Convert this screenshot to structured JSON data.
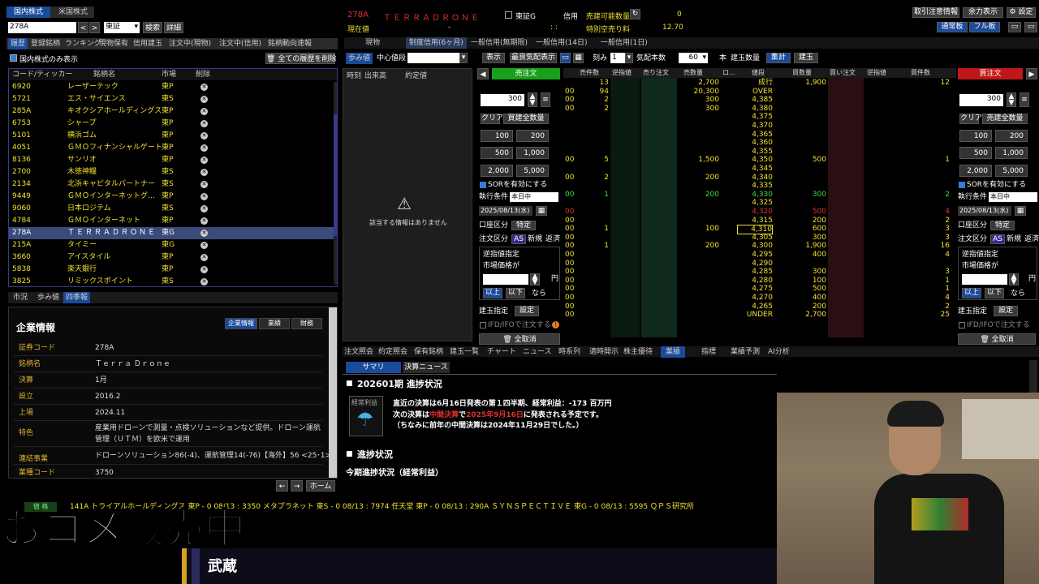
{
  "top_left": {
    "tab_jp": "国内株式",
    "tab_us": "米国株式",
    "code_input": "278A",
    "market": "東証",
    "search": "検索",
    "detail": "詳細"
  },
  "nav_tabs": [
    "履歴",
    "登録銘柄",
    "ランキング",
    "現物保有",
    "信用建玉",
    "注文中(現物)",
    "注文中(信用)",
    "銘柄動向速報"
  ],
  "domestic_only": "国内株式のみ表示",
  "clear_history": "全ての履歴を削除",
  "list_headers": {
    "code": "コード/ティッカー",
    "name": "銘柄名",
    "market": "市場",
    "del": "削除"
  },
  "stocks": [
    {
      "code": "6920",
      "name": "レーザーテック",
      "mkt": "東P"
    },
    {
      "code": "5721",
      "name": "エス・サイエンス",
      "mkt": "東S"
    },
    {
      "code": "285A",
      "name": "キオクシアホールディングス",
      "mkt": "東P"
    },
    {
      "code": "6753",
      "name": "シャープ",
      "mkt": "東P"
    },
    {
      "code": "5101",
      "name": "横浜ゴム",
      "mkt": "東P"
    },
    {
      "code": "4051",
      "name": "ＧＭＯフィナンシャルゲート",
      "mkt": "東P"
    },
    {
      "code": "8136",
      "name": "サンリオ",
      "mkt": "東P"
    },
    {
      "code": "2700",
      "name": "木徳神糧",
      "mkt": "東S"
    },
    {
      "code": "2134",
      "name": "北浜キャピタルパートナー",
      "mkt": "東S"
    },
    {
      "code": "9449",
      "name": "ＧＭＯインターネットグ…",
      "mkt": "東P"
    },
    {
      "code": "9060",
      "name": "日本ロジテム",
      "mkt": "東S"
    },
    {
      "code": "4784",
      "name": "ＧＭＯインターネット",
      "mkt": "東P"
    },
    {
      "code": "278A",
      "name": "ＴＥＲＲＡＤＲＯＮＥ",
      "mkt": "東G"
    },
    {
      "code": "215A",
      "name": "タイミー",
      "mkt": "東G"
    },
    {
      "code": "3660",
      "name": "アイスタイル",
      "mkt": "東P"
    },
    {
      "code": "5838",
      "name": "楽天銀行",
      "mkt": "東P"
    },
    {
      "code": "3825",
      "name": "リミックスポイント",
      "mkt": "東S"
    }
  ],
  "info_tabs": [
    "市況",
    "歩み値",
    "四季報"
  ],
  "company": {
    "title": "企業情報",
    "btns": [
      "企業情報",
      "業績",
      "財務"
    ],
    "rows": [
      {
        "k": "証券コード",
        "v": "278A"
      },
      {
        "k": "銘柄名",
        "v": "Ｔｅｒｒａ Ｄｒｏｎｅ"
      },
      {
        "k": "決算",
        "v": "1月"
      },
      {
        "k": "設立",
        "v": "2016.2"
      },
      {
        "k": "上場",
        "v": "2024.11"
      },
      {
        "k": "特色",
        "v": "産業用ドローンで測量・点検ソリューションなど提供。ドローン運航管理（ＵＴＭ）を欧米で運用"
      },
      {
        "k": "連結事業",
        "v": "ドローンソリューション86(-4)、運航管理14(-76)【海外】56 <25･1>"
      },
      {
        "k": "業種コード",
        "v": "3750"
      }
    ],
    "home": "ホーム"
  },
  "header": {
    "code": "278A",
    "name": "ＴＥＲＲＡＤＲＯＮＥ",
    "exch": "東証G",
    "credit": "信用",
    "sell_avail": "売建可能数量",
    "sell_avail_val": "0",
    "current": "現在値",
    "current_val": "-",
    "time": ": :",
    "special_fee": "特別空売り料",
    "special_fee_val": "12.70"
  },
  "top_right": {
    "notice": "取引注意情報",
    "remain": "余力表示",
    "settings": "設定",
    "normal": "通常板",
    "full": "フル板"
  },
  "order_tabs": [
    "現物",
    "制度信用(6ヶ月)",
    "一般信用(無期限)",
    "一般信用(14日)",
    "一般信用(1日)"
  ],
  "ayumi": {
    "tab": "歩み値",
    "center": "中心値段",
    "display": "表示",
    "recent": "最良気配表示",
    "tick_label": "刻み",
    "tick": "1",
    "quote_label": "気配本数",
    "quote": "60",
    "unit": "本",
    "pos_label": "建玉数量",
    "agg": "集計",
    "pos": "建玉",
    "cols": [
      "時刻",
      "出来高",
      "約定値"
    ],
    "empty": "該当する情報はありません"
  },
  "sell_panel": {
    "title": "売注文",
    "qty": "300",
    "clear": "クリア",
    "allqty": "買建全数量",
    "btns": [
      "100",
      "200",
      "500",
      "1,000",
      "2,000",
      "5,000"
    ],
    "sor": "SORを有効にする",
    "exec": "執行条件",
    "exec_val": "本日中",
    "date": "2025/08/13(水)",
    "acct": "口座区分",
    "acct_val": "特定",
    "otype": "注文区分",
    "as": "AS",
    "new": "新規",
    "close": "返済",
    "rev": "逆指値指定",
    "mkt_price": "市場価格が",
    "yen": "円",
    "up": "以上",
    "down": "以下",
    "then": "なら",
    "pos_spec": "建玉指定",
    "set": "設定",
    "ifd": "IFD/IFOで注文する",
    "cancel_all": "全取消"
  },
  "buy_panel": {
    "title": "買注文",
    "qty": "300",
    "clear": "クリア",
    "allqty": "売建全数量",
    "btns": [
      "100",
      "200",
      "500",
      "1,000",
      "2,000",
      "5,000"
    ],
    "sor": "SORを有効にする",
    "exec": "執行条件",
    "exec_val": "本日中",
    "date": "2025/08/13(水)",
    "acct": "口座区分",
    "acct_val": "特定",
    "otype": "注文区分",
    "as": "AS",
    "new": "新規",
    "close": "返済",
    "rev": "逆指値指定",
    "mkt_price": "市場価格が",
    "yen": "円",
    "up": "以上",
    "down": "以下",
    "then": "なら",
    "pos_spec": "建玉指定",
    "set": "設定",
    "ifd": "IFD/IFOで注文する",
    "cancel_all": "全取消"
  },
  "board_headers": [
    "売件数",
    "逆指値",
    "売り注文",
    "売数量",
    "ロ…",
    "値段",
    "買数量",
    "買い注文",
    "逆指値",
    "買件数"
  ],
  "board": [
    {
      "sc": "13",
      "sq": "2,700",
      "p": "成行",
      "bq": "1,900",
      "bc": "12"
    },
    {
      "l": "00",
      "sc": "94",
      "sq": "20,300",
      "p": "OVER"
    },
    {
      "l": "00",
      "sc": "2",
      "sq": "300",
      "p": "4,385"
    },
    {
      "l": "00",
      "sc": "2",
      "sq": "300",
      "p": "4,380"
    },
    {
      "p": "4,375"
    },
    {
      "p": "4,370"
    },
    {
      "p": "4,365"
    },
    {
      "p": "4,360"
    },
    {
      "p": "4,355"
    },
    {
      "l": "00",
      "sc": "5",
      "sq": "1,500",
      "p": "4,350",
      "bq": "500",
      "bc": "1"
    },
    {
      "p": "4,345"
    },
    {
      "l": "00",
      "sc": "2",
      "sq": "200",
      "p": "4,340"
    },
    {
      "p": "4,335"
    },
    {
      "l": "00",
      "sc": "1",
      "sq": "200",
      "p": "4,330",
      "bq": "300",
      "bc": "2",
      "g": 1
    },
    {
      "p": "4,325"
    },
    {
      "l": "00",
      "p": "4,320",
      "bq": "500",
      "bc": "4",
      "r": 1
    },
    {
      "l": "00",
      "p": "4,315",
      "bq": "200",
      "bc": "2"
    },
    {
      "l": "00",
      "sc": "1",
      "sq": "100",
      "p": "4,310",
      "bq": "600",
      "bc": "3",
      "box": 1
    },
    {
      "l": "00",
      "p": "4,305",
      "bq": "300",
      "bc": "3"
    },
    {
      "l": "00",
      "sc": "1",
      "sq": "200",
      "p": "4,300",
      "bq": "1,900",
      "bc": "16"
    },
    {
      "l": "00",
      "p": "4,295",
      "bq": "400",
      "bc": "4"
    },
    {
      "l": "00",
      "p": "4,290"
    },
    {
      "l": "00",
      "p": "4,285",
      "bq": "300",
      "bc": "3"
    },
    {
      "l": "00",
      "p": "4,280",
      "bq": "100",
      "bc": "1"
    },
    {
      "l": "00",
      "p": "4,275",
      "bq": "500",
      "bc": "1"
    },
    {
      "l": "00",
      "p": "4,270",
      "bq": "400",
      "bc": "4"
    },
    {
      "l": "00",
      "p": "4,265",
      "bq": "200",
      "bc": "2"
    },
    {
      "l": "00",
      "p": "UNDER",
      "bq": "2,700",
      "bc": "25"
    }
  ],
  "bottom_tabs": [
    "注文照会",
    "約定照会",
    "保有銘柄",
    "建玉一覧",
    "チャート",
    "ニュース",
    "時系列",
    "適時開示",
    "株主優待",
    "業績",
    "指標",
    "業績予測",
    "AI分析"
  ],
  "summary": {
    "tabs": [
      "サマリ",
      "決算ニュース"
    ],
    "h1": "202601期 進捗状況",
    "badge": "経常利益",
    "l1": "直近の決算は6月16日発表の第１四半期、経常利益：-173 百万円",
    "l2a": "次の決算は",
    "l2b": "中間決算",
    "l2c": "で",
    "l2d": "2025年9月16日",
    "l2e": "に発表される予定です。",
    "l3": "（ちなみに前年の中間決算は2024年11月29日でした。）",
    "h2": "進捗状況",
    "l4": "今期進捗状況（経常利益）"
  },
  "ticker": {
    "label": "値 格",
    "text": "141A トライアルホールディングス 東P - 0 08/13 :   3350 メタプラネット 東S - 0 08/13 :   7974 任天堂 東P - 0 08/13 :   290A ＳＹＮＳＰＥＣＴＩＶＥ 東G - 0 08/13 :   5595 ＱＰＳ研究所"
  },
  "overlay": {
    "text": "おコメ販売中",
    "name": "武蔵"
  }
}
